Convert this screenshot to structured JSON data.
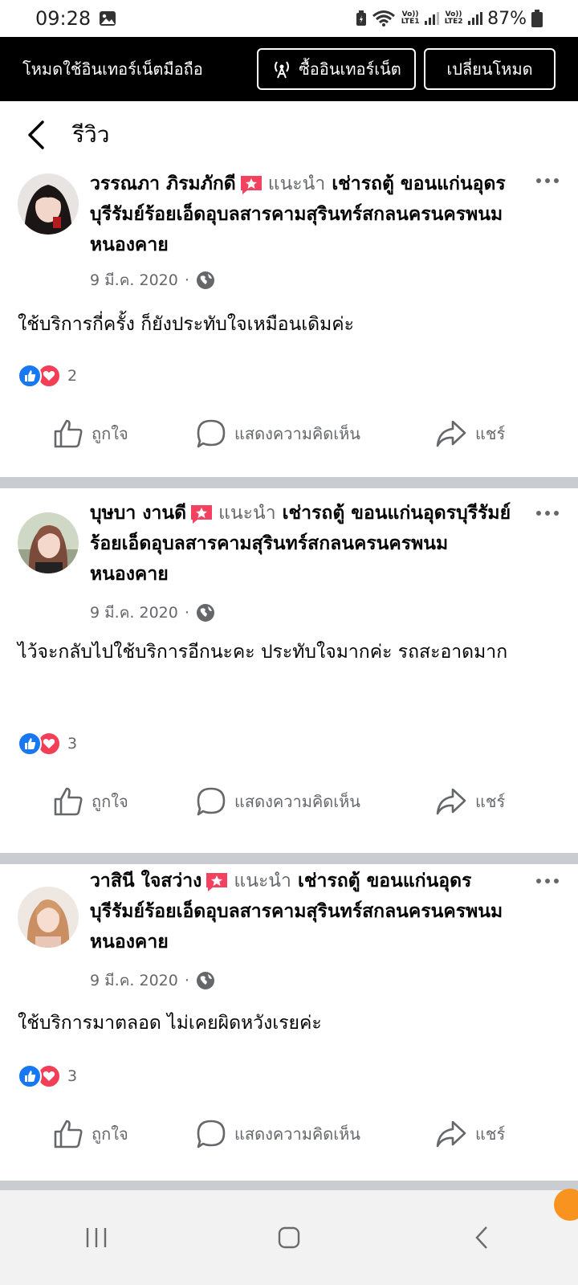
{
  "status_bar": {
    "time": "09:28",
    "sim1_label": "Vo)) LTE1",
    "sim2_label": "Vo)) LTE2",
    "battery": "87%"
  },
  "mode_banner": {
    "text": "โหมดใช้อินเทอร์เน็ตมือถือ",
    "buy_label": "ซื้ออินเทอร์เน็ต",
    "switch_label": "เปลี่ยนโหมด"
  },
  "header": {
    "title": "รีวิว"
  },
  "reviews": [
    {
      "name": "วรรณภา ภิรมภักดี",
      "recommend": "แนะนำ",
      "page": "เช่ารถตู้ ขอนแก่นอุดรบุรีรัมย์ร้อยเอ็ดอุบลสารคามสุรินทร์สกลนครนครพนมหนองคาย",
      "date": "9 มี.ค. 2020",
      "text": "ใช้บริการกี่ครั้ง ก็ยังประทับใจเหมือนเดิมค่ะ",
      "reaction_count": "2"
    },
    {
      "name": "บุษบา งานดี",
      "recommend": "แนะนำ",
      "page": "เช่ารถตู้ ขอนแก่นอุดรบุรีรัมย์ร้อยเอ็ดอุบลสารคามสุรินทร์สกลนครนครพนมหนองคาย",
      "date": "9 มี.ค. 2020",
      "text": "ไว้จะกลับไปใช้บริการอีกนะคะ ประทับใจมากค่ะ รถสะอาดมาก",
      "reaction_count": "3"
    },
    {
      "name": "วาสินี ใจสว่าง",
      "recommend": "แนะนำ",
      "page": "เช่ารถตู้ ขอนแก่นอุดรบุรีรัมย์ร้อยเอ็ดอุบลสารคามสุรินทร์สกลนครนครพนมหนองคาย",
      "date": "9 มี.ค. 2020",
      "text": "ใช้บริการมาตลอด ไม่เคยผิดหวังเรยค่ะ",
      "reaction_count": "3"
    }
  ],
  "actions": {
    "like": "ถูกใจ",
    "comment": "แสดงความคิดเห็น",
    "share": "แชร์"
  },
  "colors": {
    "like_blue": "#1877f2",
    "love_red": "#f33e58",
    "recommend_red": "#f3425f",
    "separator": "#c9ccd1"
  }
}
